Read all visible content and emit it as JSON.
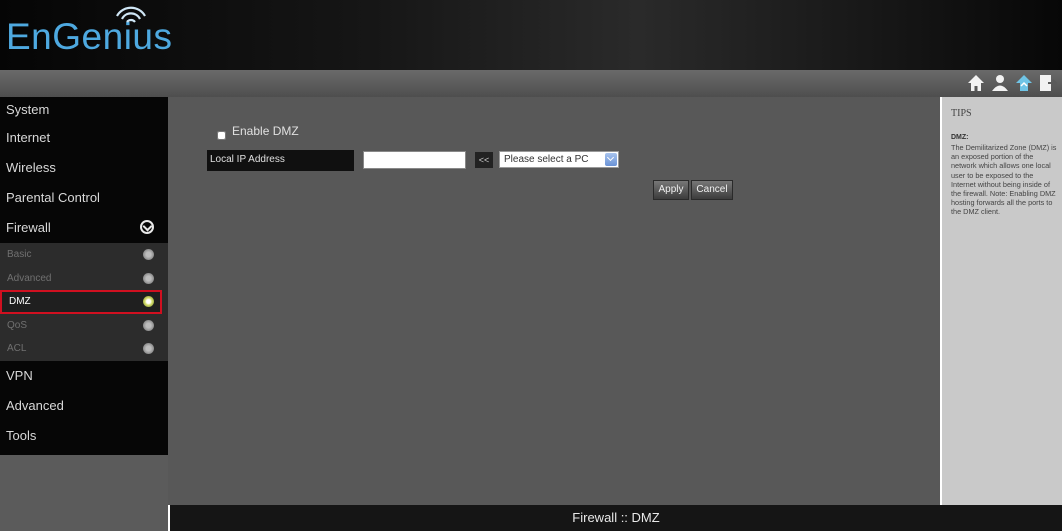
{
  "brand": {
    "name": "EnGenius",
    "color": "#4ea9e0"
  },
  "toolbar": {
    "icons": [
      "home-icon",
      "user-icon",
      "network-icon",
      "logout-icon"
    ]
  },
  "sidebar": {
    "items": [
      {
        "label": "System"
      },
      {
        "label": "Internet"
      },
      {
        "label": "Wireless"
      },
      {
        "label": "Parental Control"
      },
      {
        "label": "Firewall",
        "expanded": true
      }
    ],
    "firewall_subitems": [
      {
        "label": "Basic"
      },
      {
        "label": "Advanced"
      },
      {
        "label": "DMZ",
        "active": true
      },
      {
        "label": "QoS"
      },
      {
        "label": "ACL"
      }
    ],
    "items_after": [
      {
        "label": "VPN"
      },
      {
        "label": "Advanced"
      },
      {
        "label": "Tools"
      }
    ]
  },
  "main": {
    "enable_dmz_label": "Enable DMZ",
    "enable_dmz_checked": false,
    "local_ip_label": "Local IP Address",
    "local_ip_value": "",
    "arrow_button": "<<",
    "pc_select": "Please select a PC",
    "apply_label": "Apply",
    "cancel_label": "Cancel"
  },
  "tips": {
    "title": "TIPS",
    "heading": "DMZ:",
    "body": "The Demilitarized Zone (DMZ) is an exposed portion of the network which allows one local user to be exposed to the Internet without being inside of the firewall. Note: Enabling DMZ hosting forwards all the ports to the DMZ client."
  },
  "footer": {
    "breadcrumb": "Firewall :: DMZ"
  },
  "colors": {
    "active_outline": "#d01020",
    "main_bg": "#585858",
    "tips_bg": "#c9c9c9"
  }
}
